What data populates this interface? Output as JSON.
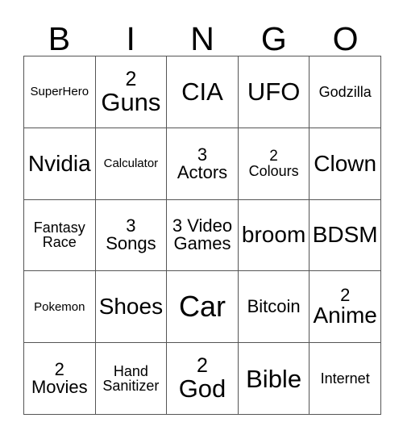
{
  "card": {
    "header": {
      "letters": [
        "B",
        "I",
        "N",
        "G",
        "O"
      ]
    },
    "columns": 5,
    "rows": 5,
    "colors": {
      "background": "#ffffff",
      "text": "#000000",
      "grid_line": "#555555"
    },
    "cells": [
      [
        {
          "text": "SuperHero",
          "lines": [
            "SuperHero"
          ],
          "size": "xxs"
        },
        {
          "text": "2 Guns",
          "lines": [
            "2",
            "Guns"
          ],
          "size": "lg",
          "number_size": "lg"
        },
        {
          "text": "CIA",
          "lines": [
            "CIA"
          ],
          "size": "lg"
        },
        {
          "text": "UFO",
          "lines": [
            "UFO"
          ],
          "size": "lg"
        },
        {
          "text": "Godzilla",
          "lines": [
            "Godzilla"
          ],
          "size": "xs"
        }
      ],
      [
        {
          "text": "Nvidia",
          "lines": [
            "Nvidia"
          ],
          "size": "md"
        },
        {
          "text": "Calculator",
          "lines": [
            "Calculator"
          ],
          "size": "xxs"
        },
        {
          "text": "3 Actors",
          "lines": [
            "3",
            "Actors"
          ],
          "size": "sm",
          "number_size": "md"
        },
        {
          "text": "2 Colours",
          "lines": [
            "2",
            "Colours"
          ],
          "size": "xs",
          "number_size": "sm"
        },
        {
          "text": "Clown",
          "lines": [
            "Clown"
          ],
          "size": "md"
        }
      ],
      [
        {
          "text": "Fantasy Race",
          "lines": [
            "Fantasy",
            "Race"
          ],
          "size": "xs"
        },
        {
          "text": "3 Songs",
          "lines": [
            "3",
            "Songs"
          ],
          "size": "sm",
          "number_size": "md"
        },
        {
          "text": "3 Video Games",
          "lines": [
            "3 Video",
            "Games"
          ],
          "size": "sm"
        },
        {
          "text": "broom",
          "lines": [
            "broom"
          ],
          "size": "md"
        },
        {
          "text": "BDSM",
          "lines": [
            "BDSM"
          ],
          "size": "md"
        }
      ],
      [
        {
          "text": "Pokemon",
          "lines": [
            "Pokemon"
          ],
          "size": "xxs"
        },
        {
          "text": "Shoes",
          "lines": [
            "Shoes"
          ],
          "size": "md"
        },
        {
          "text": "Car",
          "lines": [
            "Car"
          ],
          "size": "xl"
        },
        {
          "text": "Bitcoin",
          "lines": [
            "Bitcoin"
          ],
          "size": "sm"
        },
        {
          "text": "2 Anime",
          "lines": [
            "2",
            "Anime"
          ],
          "size": "md",
          "number_size": "md"
        }
      ],
      [
        {
          "text": "2 Movies",
          "lines": [
            "2",
            "Movies"
          ],
          "size": "sm",
          "number_size": "md"
        },
        {
          "text": "Hand Sanitizer",
          "lines": [
            "Hand",
            "Sanitizer"
          ],
          "size": "xs"
        },
        {
          "text": "2 God",
          "lines": [
            "2",
            "God"
          ],
          "size": "lg",
          "number_size": "lg"
        },
        {
          "text": "Bible",
          "lines": [
            "Bible"
          ],
          "size": "lg"
        },
        {
          "text": "Internet",
          "lines": [
            "Internet"
          ],
          "size": "xs"
        }
      ]
    ]
  }
}
